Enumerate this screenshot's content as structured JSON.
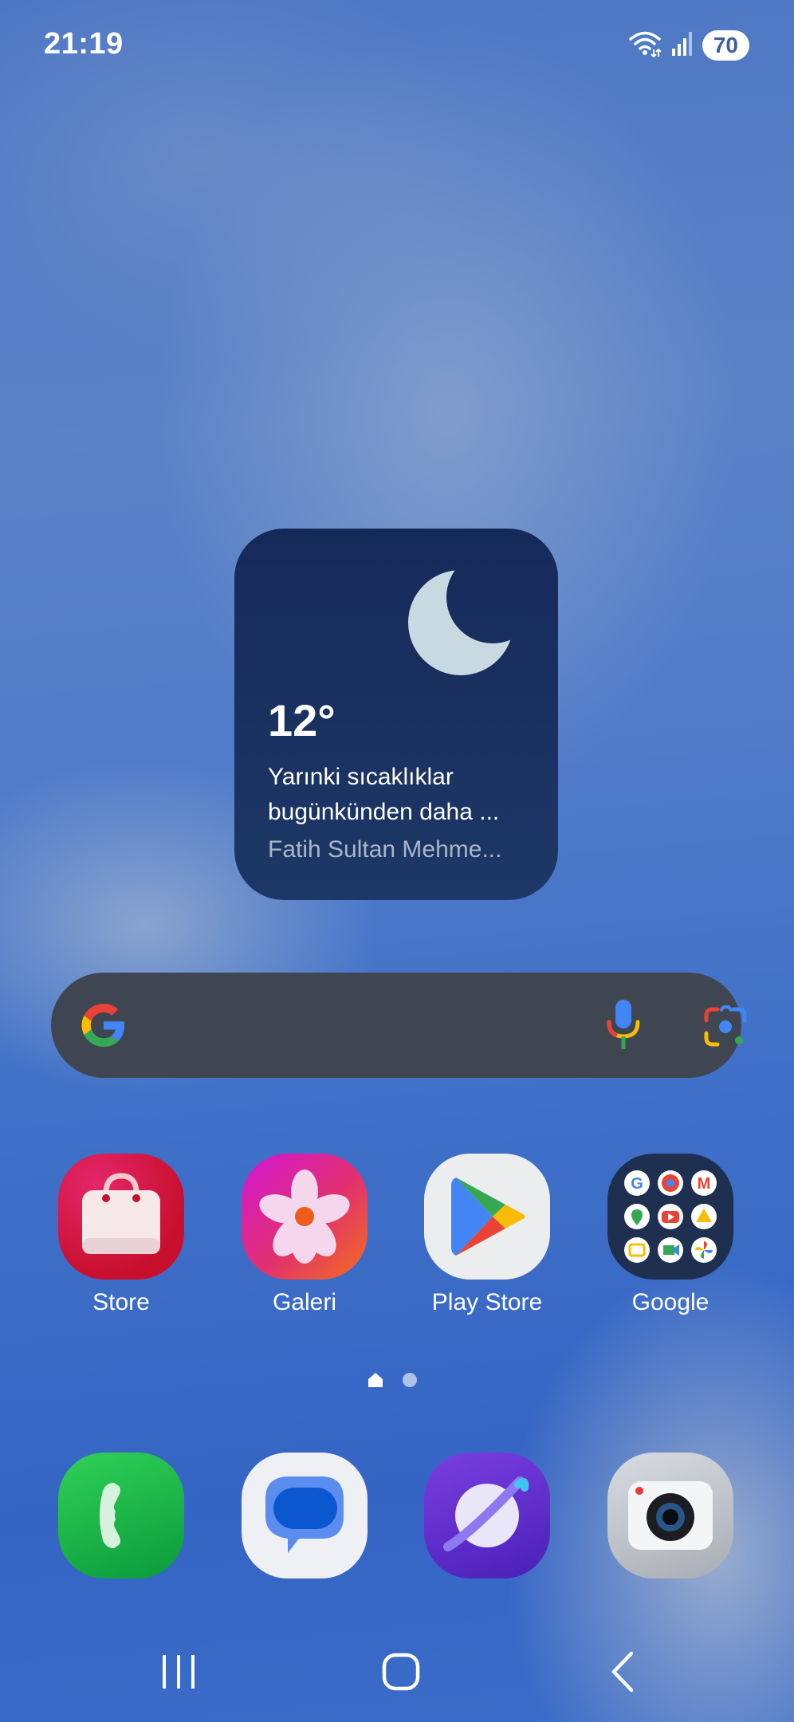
{
  "status_bar": {
    "time": "21:19",
    "battery": "70",
    "icons": [
      "wifi-icon",
      "signal-icon"
    ]
  },
  "weather_widget": {
    "temperature": "12°",
    "description": "Yarınki sıcaklıklar bugünkünden daha ...",
    "location": "Fatih Sultan Mehme...",
    "icon": "moon-icon"
  },
  "search_bar": {
    "icons": [
      "google-logo-icon",
      "microphone-icon",
      "google-lens-icon"
    ]
  },
  "home_apps": [
    {
      "label": "Store",
      "icon": "galaxy-store-icon"
    },
    {
      "label": "Galeri",
      "icon": "gallery-icon"
    },
    {
      "label": "Play Store",
      "icon": "play-store-icon"
    },
    {
      "label": "Google",
      "icon": "google-folder-icon"
    }
  ],
  "page_indicator": {
    "pages": 2,
    "current": 1
  },
  "dock": [
    {
      "icon": "phone-icon"
    },
    {
      "icon": "messages-icon"
    },
    {
      "icon": "internet-browser-icon"
    },
    {
      "icon": "camera-icon"
    }
  ],
  "nav_bar": {
    "buttons": [
      "recents-button",
      "home-button",
      "back-button"
    ]
  },
  "colors": {
    "widget_bg": "#162a5a",
    "search_bg": "#404651",
    "moon": "#c8d9e2"
  }
}
